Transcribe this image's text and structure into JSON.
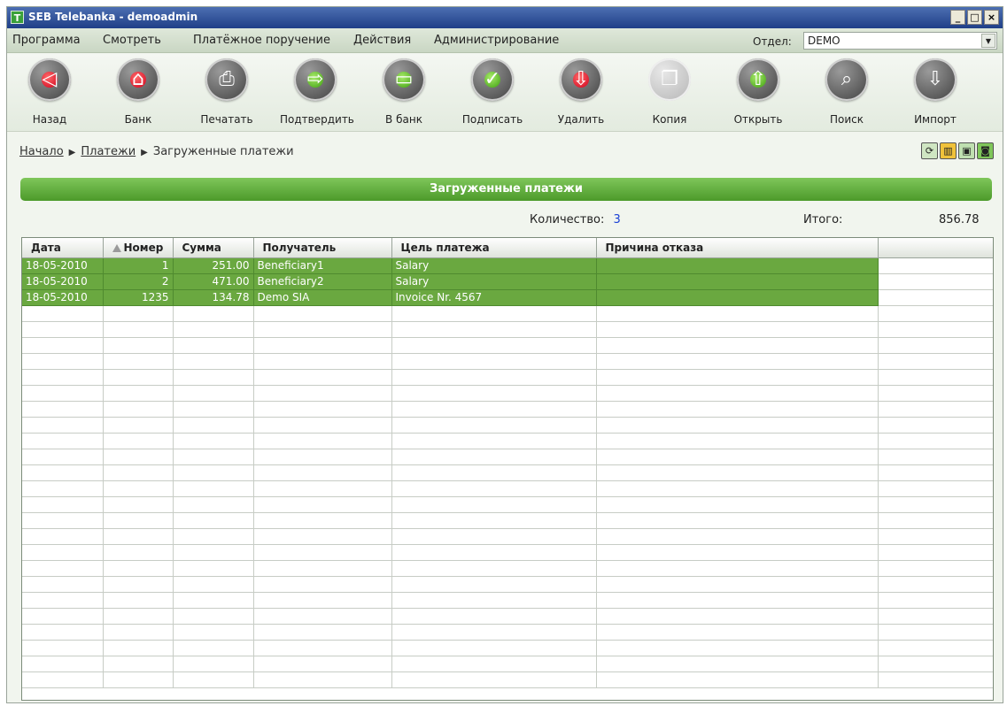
{
  "window": {
    "title": "SEB Telebanka - demoadmin",
    "app_icon_letter": "T",
    "controls": {
      "minimize": "_",
      "maximize": "□",
      "close": "×"
    }
  },
  "menu": {
    "items": [
      "Программа",
      "Смотреть",
      "Платёжное поручение",
      "Действия",
      "Администрирование"
    ],
    "dept_label": "Отдел:",
    "dept_value": "DEMO"
  },
  "toolbar": {
    "buttons": [
      {
        "label": "Назад",
        "icon": "back-arrow-icon",
        "enabled": true
      },
      {
        "label": "Банк",
        "icon": "bank-icon",
        "enabled": true
      },
      {
        "label": "Печатать",
        "icon": "printer-icon",
        "enabled": true
      },
      {
        "label": "Подтвердить",
        "icon": "confirm-icon",
        "enabled": true
      },
      {
        "label": "В банк",
        "icon": "send-to-bank-icon",
        "enabled": true
      },
      {
        "label": "Подписать",
        "icon": "sign-icon",
        "enabled": true
      },
      {
        "label": "Удалить",
        "icon": "delete-icon",
        "enabled": true
      },
      {
        "label": "Копия",
        "icon": "copy-icon",
        "enabled": false
      },
      {
        "label": "Открыть",
        "icon": "open-icon",
        "enabled": true
      },
      {
        "label": "Поиск",
        "icon": "search-icon",
        "enabled": true
      },
      {
        "label": "Импорт",
        "icon": "import-icon",
        "enabled": true
      }
    ]
  },
  "breadcrumb": {
    "home": "Начало",
    "payments": "Платежи",
    "current": "Загруженные платежи"
  },
  "section": {
    "title": "Загруженные платежи",
    "count_label": "Количество:",
    "count_value": "3",
    "total_label": "Итого:",
    "total_value": "856.78"
  },
  "table": {
    "columns": [
      "Дата",
      "Номер",
      "Сумма",
      "Получатель",
      "Цель платежа",
      "Причина отказа",
      ""
    ],
    "rows": [
      [
        "18-05-2010",
        "1",
        "251.00",
        "Beneficiary1",
        "Salary",
        ""
      ],
      [
        "18-05-2010",
        "2",
        "471.00",
        "Beneficiary2",
        "Salary",
        ""
      ],
      [
        "18-05-2010",
        "1235",
        "134.78",
        "Demo SIA",
        "Invoice Nr. 4567",
        ""
      ]
    ]
  },
  "colors": {
    "accent_green": "#6aa840",
    "header_green": "#4c9a2a",
    "link_blue": "#1a40d6"
  }
}
